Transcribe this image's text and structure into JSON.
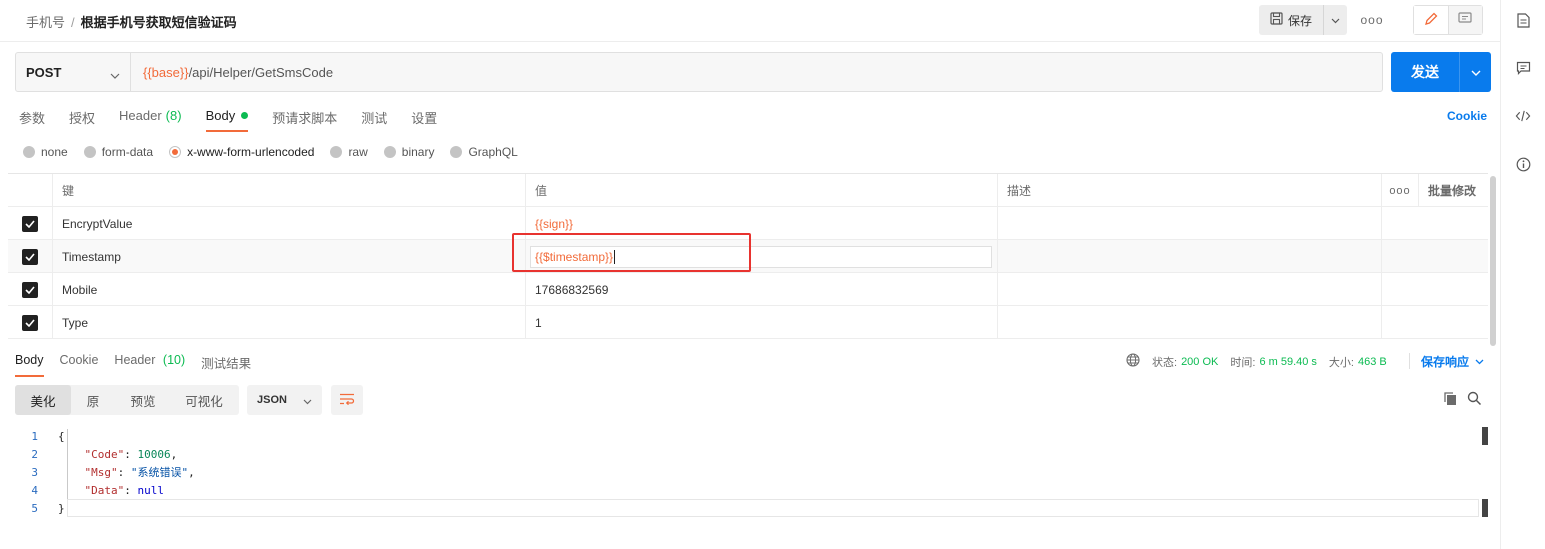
{
  "breadcrumb": {
    "parent": "手机号",
    "separator": "/",
    "current": "根据手机号获取短信验证码"
  },
  "toolbar": {
    "save_label": "保存",
    "more_label": "ooo"
  },
  "request": {
    "method": "POST",
    "url_var": "{{base}}",
    "url_path": "/api/Helper/GetSmsCode",
    "send_label": "发送"
  },
  "req_tabs": {
    "params": "参数",
    "auth": "授权",
    "header": "Header",
    "header_count": "(8)",
    "body": "Body",
    "prerequest": "预请求脚本",
    "tests": "测试",
    "settings": "设置"
  },
  "cookie_label": "Cookie",
  "body_types": [
    "none",
    "form-data",
    "x-www-form-urlencoded",
    "raw",
    "binary",
    "GraphQL"
  ],
  "body_type_selected": "x-www-form-urlencoded",
  "table": {
    "headers": {
      "key": "键",
      "value": "值",
      "desc": "描述",
      "dots": "ooo",
      "bulk": "批量修改"
    },
    "rows": [
      {
        "key": "EncryptValue",
        "value": "{{sign}}"
      },
      {
        "key": "Timestamp",
        "value": "{{$timestamp}}"
      },
      {
        "key": "Mobile",
        "value": "17686832569"
      },
      {
        "key": "Type",
        "value": "1"
      }
    ]
  },
  "response": {
    "tabs": {
      "body": "Body",
      "cookie": "Cookie",
      "header": "Header",
      "header_count": "(10)",
      "results": "测试结果"
    },
    "status_label": "状态:",
    "status_value": "200 OK",
    "time_label": "时间:",
    "time_value": "6 m 59.40 s",
    "size_label": "大小:",
    "size_value": "463 B",
    "save_label": "保存响应",
    "views": [
      "美化",
      "原",
      "预览",
      "可视化"
    ],
    "format": "JSON"
  },
  "code": {
    "line_numbers": [
      "1",
      "2",
      "3",
      "4",
      "5"
    ],
    "open": "{",
    "close": "}",
    "code_key": "\"Code\"",
    "code_val": "10006",
    "msg_key": "\"Msg\"",
    "msg_val": "\"系统错误\"",
    "data_key": "\"Data\"",
    "data_val": "null"
  },
  "colors": {
    "accent": "#f26b3a",
    "primary": "#097bed",
    "success": "#0cbb52",
    "highlight": "#e8332f"
  }
}
